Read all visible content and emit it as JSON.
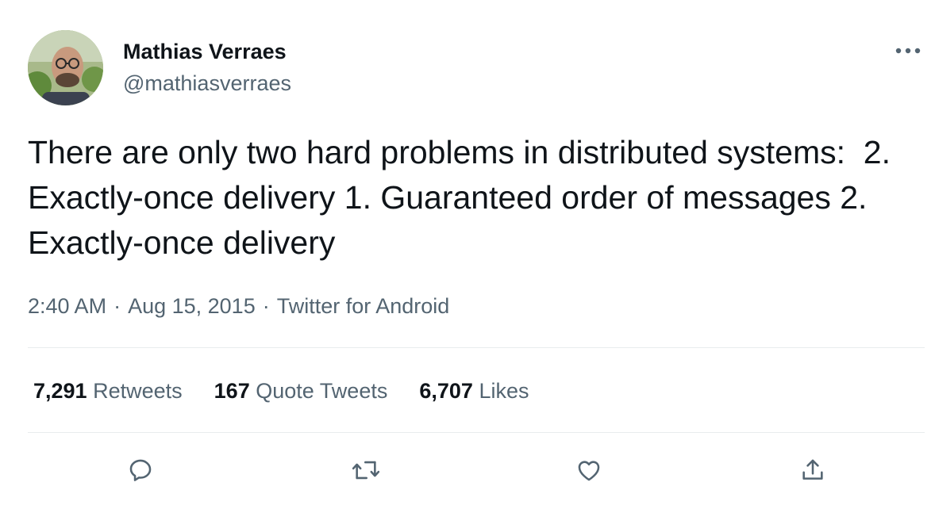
{
  "author": {
    "name": "Mathias Verraes",
    "handle": "@mathiasverraes"
  },
  "tweet": {
    "text": "There are only two hard problems in distributed systems:  2. Exactly-once delivery 1. Guaranteed order of messages 2. Exactly-once delivery",
    "time": "2:40 AM",
    "separator": "·",
    "date": "Aug 15, 2015",
    "source": "Twitter for Android"
  },
  "stats": {
    "retweets_count": "7,291",
    "retweets_label": "Retweets",
    "quotes_count": "167",
    "quotes_label": "Quote Tweets",
    "likes_count": "6,707",
    "likes_label": "Likes"
  },
  "icons": {
    "more": "more-icon",
    "reply": "reply-icon",
    "retweet": "retweet-icon",
    "like": "heart-icon",
    "share": "share-icon"
  },
  "colors": {
    "text_primary": "#0f1419",
    "text_secondary": "#536471",
    "divider": "#e8ecee"
  }
}
